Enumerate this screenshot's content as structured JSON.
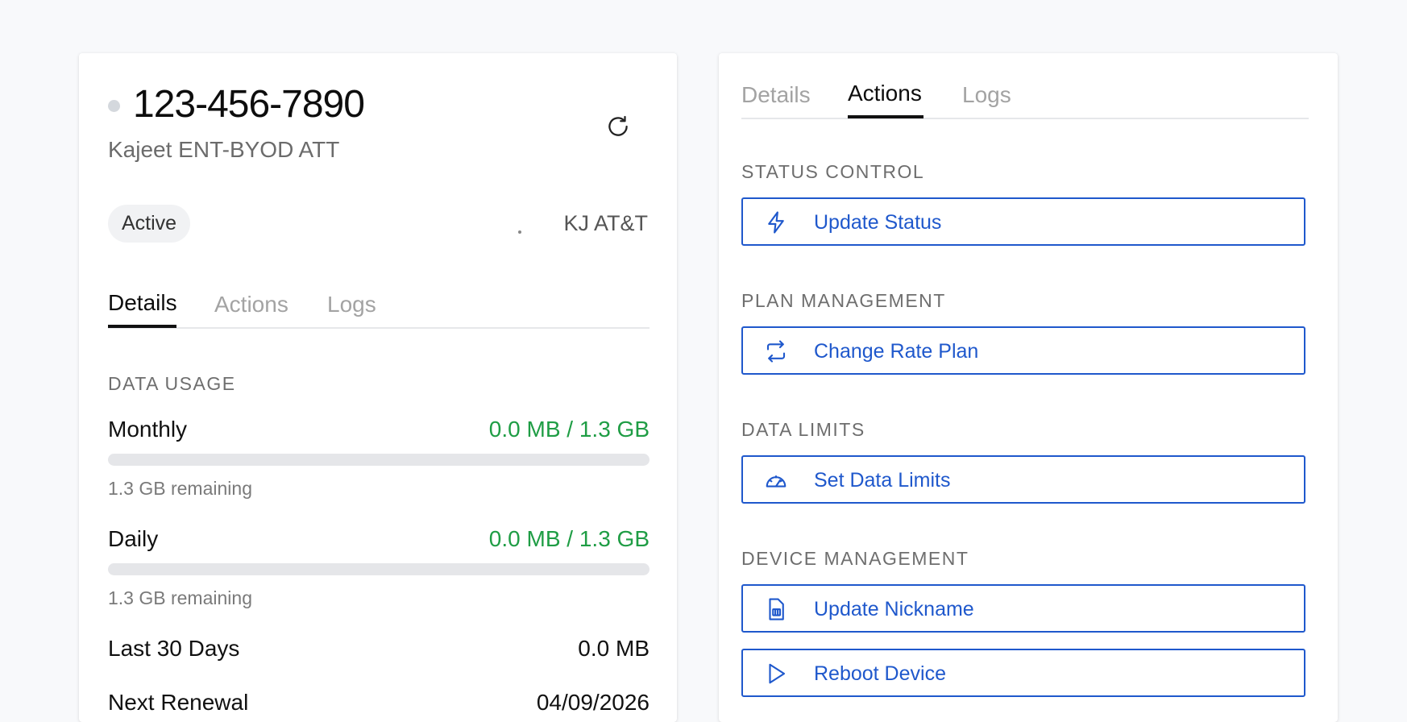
{
  "device": {
    "phone": "123-456-7890",
    "plan": "Kajeet ENT-BYOD ATT",
    "status": "Active",
    "carrier": "KJ AT&T"
  },
  "left_tabs": [
    {
      "label": "Details",
      "active": true
    },
    {
      "label": "Actions",
      "active": false
    },
    {
      "label": "Logs",
      "active": false
    }
  ],
  "right_tabs": [
    {
      "label": "Details",
      "active": false
    },
    {
      "label": "Actions",
      "active": true
    },
    {
      "label": "Logs",
      "active": false
    }
  ],
  "data_usage": {
    "section_label": "DATA USAGE",
    "monthly": {
      "label": "Monthly",
      "value": "0.0 MB / 1.3 GB",
      "remaining": "1.3 GB remaining",
      "used_fraction": 0
    },
    "daily": {
      "label": "Daily",
      "value": "0.0 MB / 1.3 GB",
      "remaining": "1.3 GB remaining",
      "used_fraction": 0
    },
    "last30": {
      "label": "Last 30 Days",
      "value": "0.0 MB"
    },
    "renewal": {
      "label": "Next Renewal",
      "value": "04/09/2026"
    }
  },
  "actions": {
    "status_control": {
      "label": "STATUS CONTROL",
      "buttons": [
        {
          "label": "Update Status",
          "icon": "bolt-icon"
        }
      ]
    },
    "plan_management": {
      "label": "PLAN MANAGEMENT",
      "buttons": [
        {
          "label": "Change Rate Plan",
          "icon": "swap-icon"
        }
      ]
    },
    "data_limits": {
      "label": "DATA LIMITS",
      "buttons": [
        {
          "label": "Set Data Limits",
          "icon": "gauge-icon"
        }
      ]
    },
    "device_management": {
      "label": "DEVICE MANAGEMENT",
      "buttons": [
        {
          "label": "Update Nickname",
          "icon": "sim-card-icon"
        },
        {
          "label": "Reboot Device",
          "icon": "play-icon"
        }
      ]
    }
  },
  "colors": {
    "accent_blue": "#1f58cc",
    "usage_green": "#1f9d45"
  }
}
